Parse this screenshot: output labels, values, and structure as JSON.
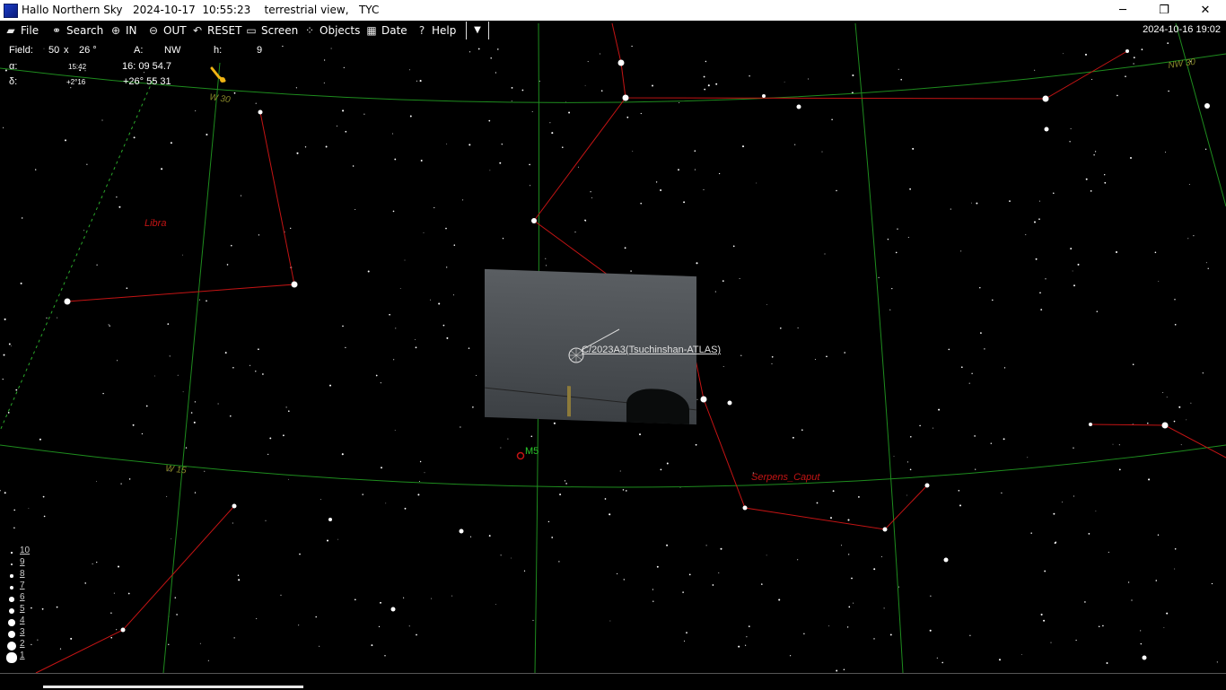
{
  "window": {
    "title": "Hallo Northern Sky   2024-10-17  10:55:23    terrestrial view,   TYC",
    "min": "─",
    "restore": "❐",
    "close": "✕"
  },
  "menu": {
    "file": "File",
    "search": "Search",
    "zoom_in": "IN",
    "zoom_out": "OUT",
    "reset": "RESET",
    "screen": "Screen",
    "objects": "Objects",
    "date": "Date",
    "help": "Help",
    "dropdown": "▼"
  },
  "datetime_right": "2024-10-16  19:02",
  "info": {
    "field_label": "Field:",
    "field_w": "50",
    "field_x": "x",
    "field_h": "26 °",
    "a_label": "A:",
    "a_value": "NW",
    "h_label": "h:",
    "h_value": "9",
    "alpha_label": "α:",
    "alpha_small": "15:42",
    "alpha_value": "16: 09 54.7",
    "delta_label": "δ:",
    "delta_small": "+2°16",
    "delta_value": "+26° 55 31"
  },
  "sky_labels": {
    "libra": "Libra",
    "serpens": "Serpens_Caput",
    "m5": "M5",
    "w30": "W 30",
    "nw30": "NW 30",
    "w15": "W 15"
  },
  "comet": {
    "label": "C/2023A3(Tsuchinshan-ATLAS)"
  },
  "mag_legend": [
    "10",
    "9",
    "8",
    "7",
    "6",
    "5",
    "4",
    "3",
    "2",
    "1"
  ],
  "colors": {
    "constellation": "#c41414",
    "grid": "#1e8c1e",
    "horizon": "#2aa82a",
    "label_red": "#c41414",
    "label_olive": "#8a8a2a",
    "pointer": "#f0b414"
  }
}
